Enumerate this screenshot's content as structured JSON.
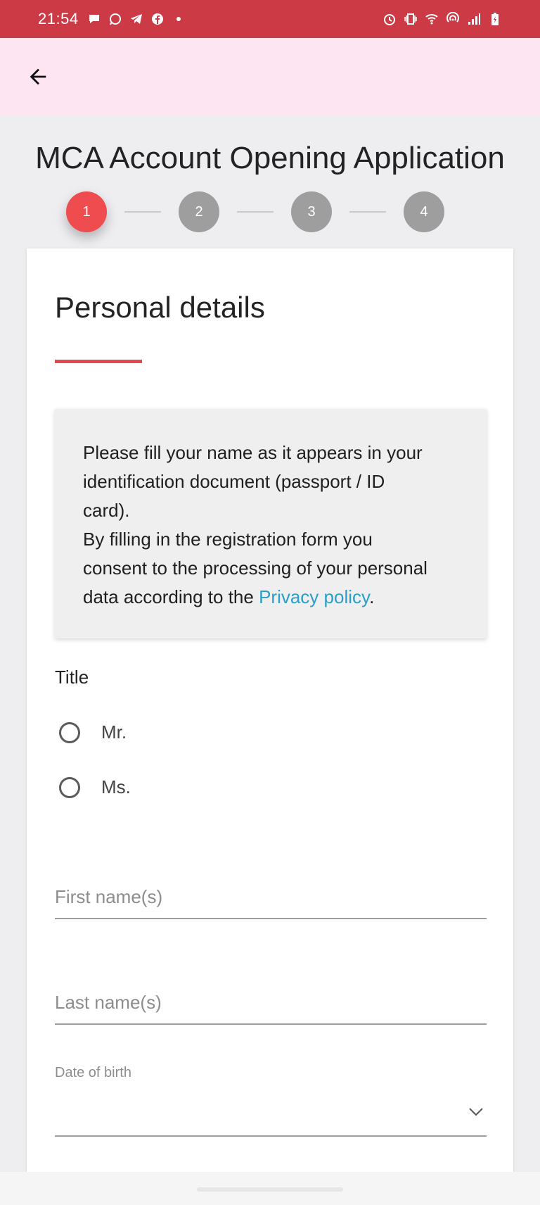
{
  "status_bar": {
    "time": "21:54",
    "left_icons": [
      "chat-bubble-icon",
      "whatsapp-icon",
      "telegram-icon",
      "facebook-icon",
      "dot-icon"
    ],
    "right_icons": [
      "alarm-icon",
      "vibrate-icon",
      "wifi-icon",
      "hotspot-icon",
      "signal-icon",
      "battery-charging-icon"
    ]
  },
  "app_bar": {
    "back_icon": "arrow-left-icon"
  },
  "page": {
    "title": "MCA Account Opening Application"
  },
  "stepper": {
    "steps": [
      {
        "label": "1",
        "active": true
      },
      {
        "label": "2",
        "active": false
      },
      {
        "label": "3",
        "active": false
      },
      {
        "label": "4",
        "active": false
      }
    ]
  },
  "form": {
    "heading": "Personal details",
    "info": {
      "line1": "Please fill your name as it appears in your",
      "line2": "identification document (passport / ID",
      "line3": "card).",
      "line4": "By filling in the registration form you",
      "line5": "consent to the processing of your personal",
      "line6_prefix": "data according to the ",
      "privacy_link": "Privacy policy",
      "line6_suffix": "."
    },
    "title_label": "Title",
    "title_options": [
      "Mr.",
      "Ms."
    ],
    "first_name_placeholder": "First name(s)",
    "last_name_placeholder": "Last name(s)",
    "dob_label": "Date of birth",
    "dob_icon": "chevron-down-icon"
  },
  "colors": {
    "status_bar": "#cc3b45",
    "app_bar": "#fde6f1",
    "accent": "#ef4c4f",
    "inactive_step": "#9e9e9e",
    "link": "#2a9fc9"
  }
}
